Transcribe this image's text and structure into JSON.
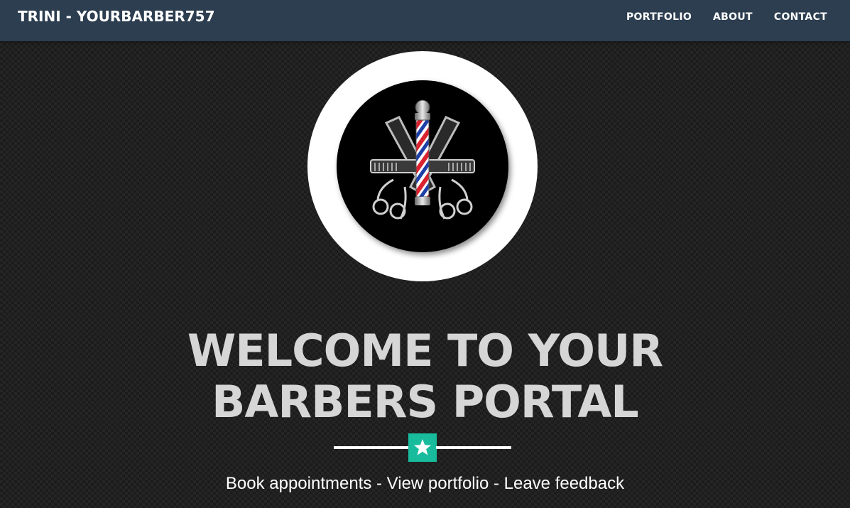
{
  "navbar": {
    "brand": "TRINI - YOURBARBER757",
    "links": [
      {
        "label": "PORTFOLIO"
      },
      {
        "label": "ABOUT"
      },
      {
        "label": "CONTACT"
      }
    ]
  },
  "hero": {
    "logo": "barber-pole-scissors-logo",
    "headline_line1": "WELCOME TO YOUR",
    "headline_line2": "BARBERS PORTAL",
    "divider_icon": "star-icon",
    "tagline": "Book appointments - View portfolio - Leave feedback"
  },
  "colors": {
    "navbar_bg": "#2c3e50",
    "accent": "#18bc9c",
    "headline": "#d6d6d6",
    "page_bg": "#1c1c1c"
  }
}
